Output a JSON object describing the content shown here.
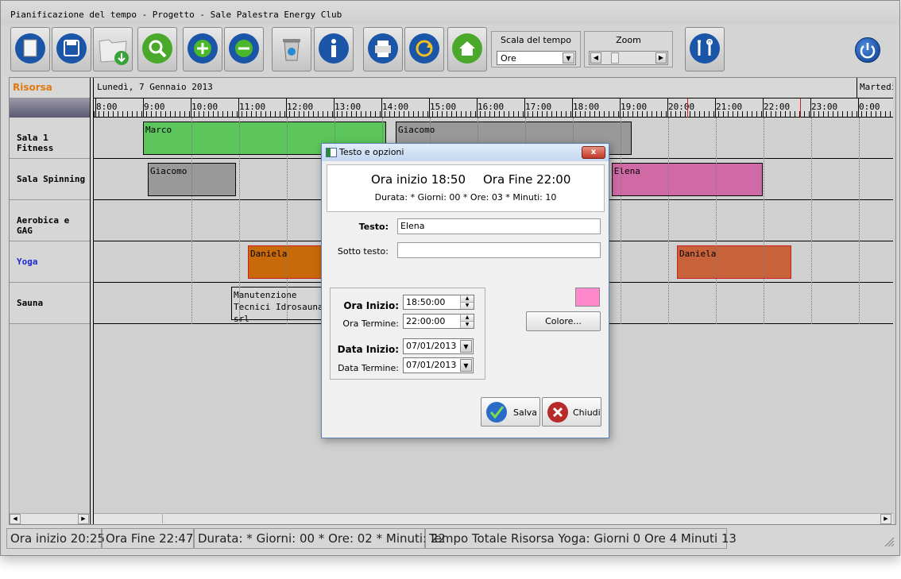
{
  "window": {
    "title": "Pianificazione del tempo  - Progetto - Sale Palestra Energy Club"
  },
  "toolbar": {
    "buttons": [
      {
        "name": "new-document-button",
        "icon": "document-icon"
      },
      {
        "name": "save-button",
        "icon": "floppy-disk-icon"
      },
      {
        "name": "open-folder-button",
        "icon": "folder-download-icon"
      },
      {
        "name": "search-button",
        "icon": "magnifier-icon"
      },
      {
        "name": "zoom-in-button",
        "icon": "plus-icon"
      },
      {
        "name": "zoom-out-button",
        "icon": "minus-icon"
      },
      {
        "name": "recycle-bin-button",
        "icon": "recycle-bin-icon"
      },
      {
        "name": "info-button",
        "icon": "info-icon"
      },
      {
        "name": "print-button",
        "icon": "printer-icon"
      },
      {
        "name": "refresh-button",
        "icon": "refresh-arrow-icon"
      },
      {
        "name": "home-button",
        "icon": "home-icon"
      },
      {
        "name": "tools-button",
        "icon": "tools-icon"
      }
    ],
    "scale_label": "Scala del tempo",
    "scale_value": "Ore",
    "zoom_label": "Zoom"
  },
  "grid": {
    "resource_header": "Risorsa",
    "resources": [
      {
        "name": "Sala 1 Fitness",
        "color": "#000000"
      },
      {
        "name": "Sala Spinning",
        "color": "#000000"
      },
      {
        "name": "Aerobica e GAG",
        "color": "#000000"
      },
      {
        "name": "Yoga",
        "color": "#1a2ad0"
      },
      {
        "name": "Sauna",
        "color": "#000000"
      }
    ],
    "day1": "Lunedì, 7 Gennaio 2013",
    "day2": "Martedì,",
    "hours": [
      "8:00",
      "9:00",
      "10:00",
      "11:00",
      "12:00",
      "13:00",
      "14:00",
      "15:00",
      "16:00",
      "17:00",
      "18:00",
      "19:00",
      "20:00",
      "21:00",
      "22:00",
      "23:00",
      "0:00"
    ],
    "events": [
      {
        "row": 0,
        "start": 9.0,
        "end": 14.1,
        "line1": "Marco",
        "line2": "",
        "color": "#5cc65c"
      },
      {
        "row": 0,
        "start": 14.3,
        "end": 19.25,
        "line1": "Giacomo",
        "line2": "",
        "color": "#999999"
      },
      {
        "row": 1,
        "start": 9.1,
        "end": 10.95,
        "line1": "Giacomo",
        "line2": "",
        "color": "#999999"
      },
      {
        "row": 1,
        "start": 18.83,
        "end": 22.0,
        "line1": "Elena",
        "line2": "",
        "color": "#d06aa6"
      },
      {
        "row": 3,
        "start": 11.2,
        "end": 13.0,
        "line1": "Daniela",
        "line2": "",
        "color": "#c8690a"
      },
      {
        "row": 3,
        "start": 20.2,
        "end": 22.6,
        "line1": "Daniela",
        "line2": "",
        "color": "#c8623a"
      },
      {
        "row": 4,
        "start": 10.85,
        "end": 13.0,
        "line1": "Manutenzione",
        "line2": "Tecnici Idrosauna srl",
        "color": "#d6d6d6"
      }
    ]
  },
  "dialog": {
    "title": "Testo e opzioni",
    "close_label": "x",
    "ora_inizio_header": "Ora inizio 18:50",
    "ora_fine_header": "Ora Fine 22:00",
    "durata": "Durata: * Giorni: 00 * Ore: 03 * Minuti: 10",
    "testo_label": "Testo:",
    "testo_value": "Elena",
    "sotto_testo_label": "Sotto testo:",
    "sotto_testo_value": "",
    "ora_inizio_label": "Ora Inizio:",
    "ora_inizio_value": "18:50:00",
    "ora_termine_label": "Ora Termine:",
    "ora_termine_value": "22:00:00",
    "data_inizio_label": "Data Inizio:",
    "data_inizio_value": "07/01/2013",
    "data_termine_label": "Data Termine:",
    "data_termine_value": "07/01/2013",
    "color_value": "#ff88cc",
    "colore_button": "Colore...",
    "salva_button": "Salva",
    "chiudi_button": "Chiudi"
  },
  "status": {
    "ora_inizio": "Ora inizio 20:25",
    "ora_fine": "Ora Fine 22:47",
    "durata": "Durata: * Giorni: 00 * Ore: 02 * Minuti: 22",
    "totale": "Tempo Totale Risorsa Yoga: Giorni 0 Ore 4 Minuti 13"
  }
}
